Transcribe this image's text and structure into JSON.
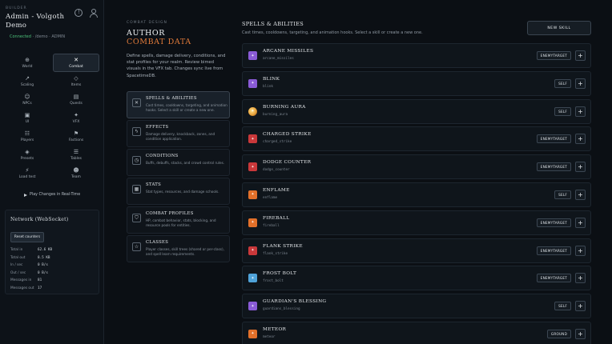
{
  "sidebar": {
    "kicker": "BUILDER",
    "title": "Admin - Volgoth Demo",
    "status": "Connected",
    "path": " · /demo · ADMIN",
    "nav": [
      {
        "label": "World",
        "icon": "globe-icon",
        "glyph": "⊕",
        "active": false
      },
      {
        "label": "Combat",
        "icon": "swords-icon",
        "glyph": "✕",
        "active": true
      },
      {
        "label": "Scaling",
        "icon": "scaling-icon",
        "glyph": "↗",
        "active": false
      },
      {
        "label": "Items",
        "icon": "shield-icon",
        "glyph": "◇",
        "active": false
      },
      {
        "label": "NPCs",
        "icon": "npc-icon",
        "glyph": "☺",
        "active": false
      },
      {
        "label": "Quests",
        "icon": "scroll-icon",
        "glyph": "▤",
        "active": false
      },
      {
        "label": "UI",
        "icon": "ui-icon",
        "glyph": "▣",
        "active": false
      },
      {
        "label": "VFX",
        "icon": "sparkle-icon",
        "glyph": "✦",
        "active": false
      },
      {
        "label": "Players",
        "icon": "players-icon",
        "glyph": "☷",
        "active": false
      },
      {
        "label": "Factions",
        "icon": "flag-icon",
        "glyph": "⚑",
        "active": false
      },
      {
        "label": "Presets",
        "icon": "presets-icon",
        "glyph": "◈",
        "active": false
      },
      {
        "label": "Tables",
        "icon": "table-icon",
        "glyph": "☰",
        "active": false
      },
      {
        "label": "Load test",
        "icon": "loadtest-icon",
        "glyph": "⚡",
        "active": false
      },
      {
        "label": "Team",
        "icon": "team-icon",
        "glyph": "☻",
        "active": false
      }
    ],
    "play_label": "Play Changes in Real-Time",
    "network": {
      "title": "Network (WebSocket)",
      "reset_label": "Reset counters",
      "stats": [
        {
          "label": "Total in",
          "value": "62.6 KB"
        },
        {
          "label": "Total out",
          "value": "8.5 KB"
        },
        {
          "label": "In / sec",
          "value": "0 B/s"
        },
        {
          "label": "Out / sec",
          "value": "0 B/s"
        },
        {
          "label": "Messages in",
          "value": "81"
        },
        {
          "label": "Messages out",
          "value": "17"
        }
      ]
    }
  },
  "middle": {
    "kicker": "COMBAT DESIGN",
    "title_line1": "AUTHOR",
    "title_line2": "COMBAT DATA",
    "description": "Define spells, damage delivery, conditions, and stat profiles for your realm. Review bimed visuals in the VFX tab. Changes sync live from SpacetimeDB.",
    "categories": [
      {
        "name": "SPELLS & ABILITIES",
        "desc": "Cast times, cooldowns, targeting, and animation hooks. Select a skill or create a new one.",
        "icon": "spell-icon",
        "glyph": "✕",
        "active": true
      },
      {
        "name": "EFFECTS",
        "desc": "Damage delivery, knockback, zones, and condition application.",
        "icon": "bolt-icon",
        "glyph": "ϟ",
        "active": false
      },
      {
        "name": "CONDITIONS",
        "desc": "Buffs, debuffs, stacks, and crowd control rules.",
        "icon": "clock-icon",
        "glyph": "◷",
        "active": false
      },
      {
        "name": "STATS",
        "desc": "Stat types, resources, and damage schools.",
        "icon": "chart-icon",
        "glyph": "▦",
        "active": false
      },
      {
        "name": "COMBAT PROFILES",
        "desc": "HP, combat behavior, stats, blocking, and resource pools for entities.",
        "icon": "shield-icon",
        "glyph": "⛉",
        "active": false
      },
      {
        "name": "CLASSES",
        "desc": "Player classes, skill trees (shared or per-class), and spell learn requirements.",
        "icon": "star-icon",
        "glyph": "☆",
        "active": false
      }
    ]
  },
  "right": {
    "title": "SPELLS & ABILITIES",
    "description": "Cast times, cooldowns, targeting, and animation hooks. Select a skill or create a new one.",
    "new_label": "NEW SKILL",
    "skills": [
      {
        "name": "ARCANE MISSILES",
        "id": "arcane_missiles",
        "target": "ENEMYTARGET",
        "color": "#8a5bd6",
        "shape": "square"
      },
      {
        "name": "BLINK",
        "id": "blink",
        "target": "SELF",
        "color": "#8a5bd6",
        "shape": "square"
      },
      {
        "name": "BURNING AURA",
        "id": "burning_aura",
        "target": "SELF",
        "color": "#e8a23a",
        "shape": "orb"
      },
      {
        "name": "CHARGED STRIKE",
        "id": "charged_strike",
        "target": "ENEMYTARGET",
        "color": "#c9383a",
        "shape": "square"
      },
      {
        "name": "DODGE COUNTER",
        "id": "dodge_counter",
        "target": "ENEMYTARGET",
        "color": "#c9383a",
        "shape": "square"
      },
      {
        "name": "ENFLAME",
        "id": "enflame",
        "target": "SELF",
        "color": "#e2702a",
        "shape": "square"
      },
      {
        "name": "FIREBALL",
        "id": "fireball",
        "target": "ENEMYTARGET",
        "color": "#e2702a",
        "shape": "square"
      },
      {
        "name": "FLANK STRIKE",
        "id": "flank_strike",
        "target": "ENEMYTARGET",
        "color": "#c9383a",
        "shape": "square"
      },
      {
        "name": "FROST BOLT",
        "id": "frost_bolt",
        "target": "ENEMYTARGET",
        "color": "#4fa3d9",
        "shape": "square"
      },
      {
        "name": "GUARDIAN'S BLESSING",
        "id": "guardians_blessing",
        "target": "SELF",
        "color": "#8a5bd6",
        "shape": "square"
      },
      {
        "name": "METEOR",
        "id": "meteor",
        "target": "GROUND",
        "color": "#e2702a",
        "shape": "square"
      }
    ]
  }
}
